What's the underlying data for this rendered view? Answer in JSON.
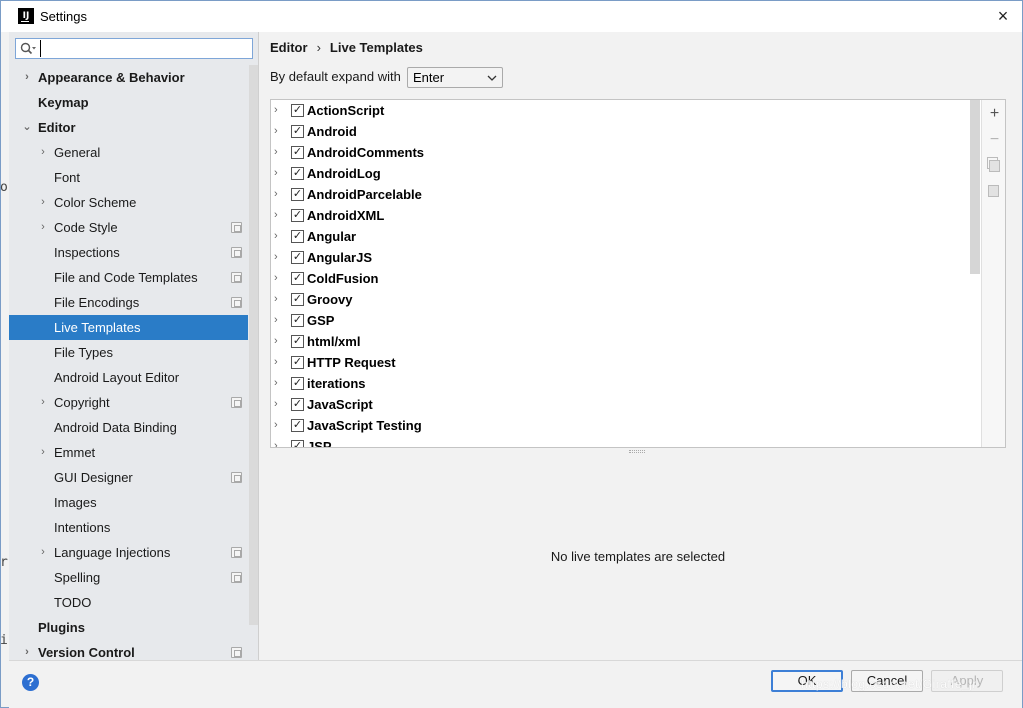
{
  "window": {
    "title": "Settings",
    "logo_text": "IJ",
    "close_glyph": "×"
  },
  "search": {
    "placeholder": "",
    "value": ""
  },
  "sidebar": {
    "items": [
      {
        "label": "Appearance & Behavior",
        "bold": true,
        "level": 0,
        "arrow": "›",
        "badge": false
      },
      {
        "label": "Keymap",
        "bold": true,
        "level": 0,
        "arrow": "",
        "badge": false
      },
      {
        "label": "Editor",
        "bold": true,
        "level": 0,
        "arrow": "⌄",
        "badge": false
      },
      {
        "label": "General",
        "bold": false,
        "level": 1,
        "arrow": "›",
        "badge": false
      },
      {
        "label": "Font",
        "bold": false,
        "level": 1,
        "arrow": "",
        "badge": false
      },
      {
        "label": "Color Scheme",
        "bold": false,
        "level": 1,
        "arrow": "›",
        "badge": false
      },
      {
        "label": "Code Style",
        "bold": false,
        "level": 1,
        "arrow": "›",
        "badge": true
      },
      {
        "label": "Inspections",
        "bold": false,
        "level": 1,
        "arrow": "",
        "badge": true
      },
      {
        "label": "File and Code Templates",
        "bold": false,
        "level": 1,
        "arrow": "",
        "badge": true
      },
      {
        "label": "File Encodings",
        "bold": false,
        "level": 1,
        "arrow": "",
        "badge": true
      },
      {
        "label": "Live Templates",
        "bold": false,
        "level": 1,
        "arrow": "",
        "badge": false,
        "selected": true
      },
      {
        "label": "File Types",
        "bold": false,
        "level": 1,
        "arrow": "",
        "badge": false
      },
      {
        "label": "Android Layout Editor",
        "bold": false,
        "level": 1,
        "arrow": "",
        "badge": false
      },
      {
        "label": "Copyright",
        "bold": false,
        "level": 1,
        "arrow": "›",
        "badge": true
      },
      {
        "label": "Android Data Binding",
        "bold": false,
        "level": 1,
        "arrow": "",
        "badge": false
      },
      {
        "label": "Emmet",
        "bold": false,
        "level": 1,
        "arrow": "›",
        "badge": false
      },
      {
        "label": "GUI Designer",
        "bold": false,
        "level": 1,
        "arrow": "",
        "badge": true
      },
      {
        "label": "Images",
        "bold": false,
        "level": 1,
        "arrow": "",
        "badge": false
      },
      {
        "label": "Intentions",
        "bold": false,
        "level": 1,
        "arrow": "",
        "badge": false
      },
      {
        "label": "Language Injections",
        "bold": false,
        "level": 1,
        "arrow": "›",
        "badge": true
      },
      {
        "label": "Spelling",
        "bold": false,
        "level": 1,
        "arrow": "",
        "badge": true
      },
      {
        "label": "TODO",
        "bold": false,
        "level": 1,
        "arrow": "",
        "badge": false
      },
      {
        "label": "Plugins",
        "bold": true,
        "level": 0,
        "arrow": "",
        "badge": false
      },
      {
        "label": "Version Control",
        "bold": true,
        "level": 0,
        "arrow": "›",
        "badge": true
      }
    ]
  },
  "breadcrumb": {
    "parent": "Editor",
    "separator": "›",
    "current": "Live Templates"
  },
  "expand": {
    "label": "By default expand with",
    "value": "Enter",
    "chevron": "⌄"
  },
  "templates": {
    "groups": [
      {
        "name": "ActionScript",
        "checked": true
      },
      {
        "name": "Android",
        "checked": true
      },
      {
        "name": "AndroidComments",
        "checked": true
      },
      {
        "name": "AndroidLog",
        "checked": true
      },
      {
        "name": "AndroidParcelable",
        "checked": true
      },
      {
        "name": "AndroidXML",
        "checked": true
      },
      {
        "name": "Angular",
        "checked": true
      },
      {
        "name": "AngularJS",
        "checked": true
      },
      {
        "name": "ColdFusion",
        "checked": true
      },
      {
        "name": "Groovy",
        "checked": true
      },
      {
        "name": "GSP",
        "checked": true
      },
      {
        "name": "html/xml",
        "checked": true
      },
      {
        "name": "HTTP Request",
        "checked": true
      },
      {
        "name": "iterations",
        "checked": true
      },
      {
        "name": "JavaScript",
        "checked": true
      },
      {
        "name": "JavaScript Testing",
        "checked": true
      },
      {
        "name": "JSP",
        "checked": true
      }
    ],
    "toolbar": {
      "add": "+",
      "remove": "−"
    },
    "empty_message": "No live templates are selected"
  },
  "footer": {
    "help": "?",
    "ok": "OK",
    "cancel": "Cancel",
    "apply": "Apply",
    "watermark": "https://blog.csdn.net/Giraffe_jr"
  },
  "backdrop": {
    "chars": [
      "o",
      "r",
      "i"
    ]
  }
}
